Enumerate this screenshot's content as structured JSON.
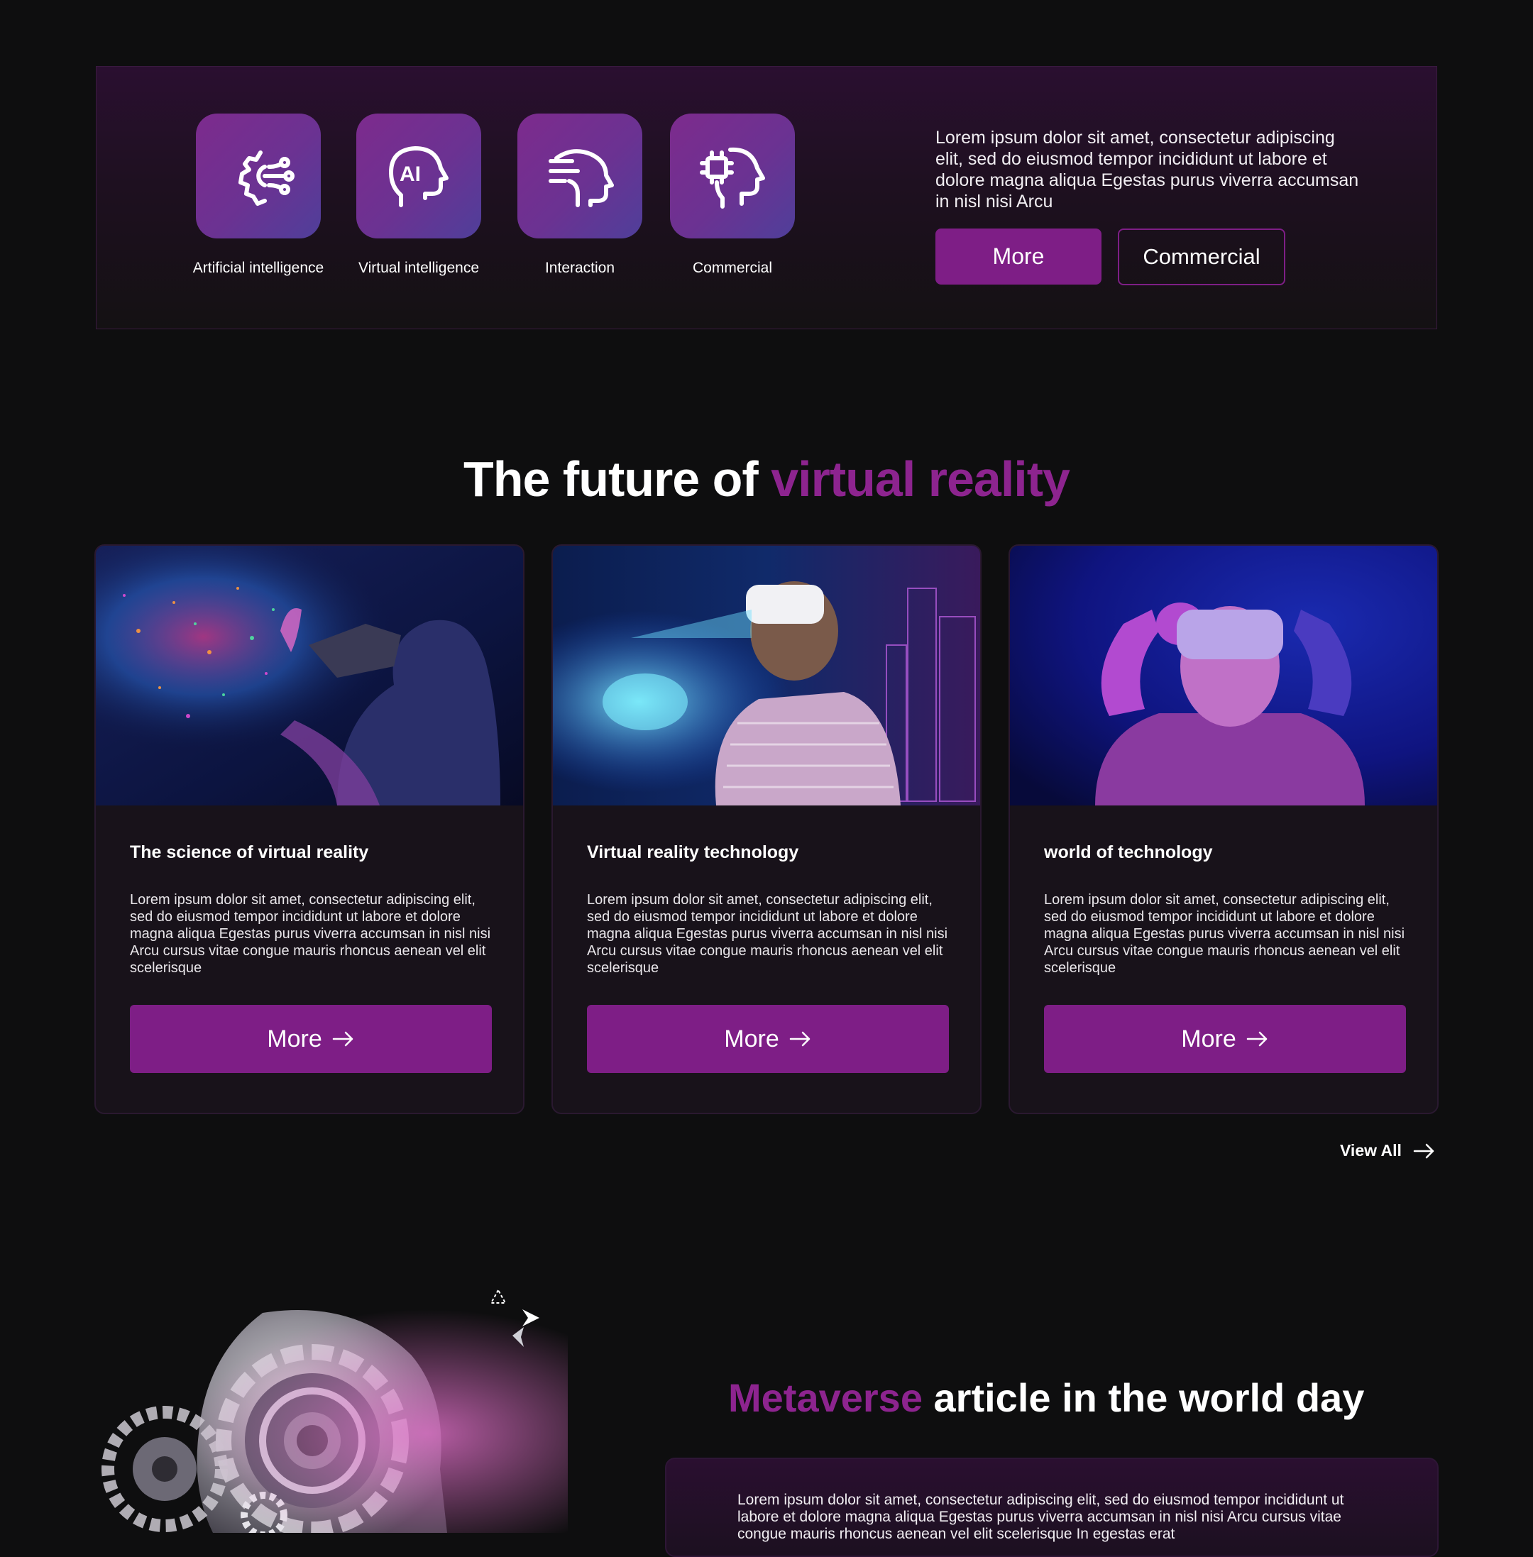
{
  "features": {
    "items": [
      {
        "label": "Artificial intelligence",
        "icon": "brain-network-icon"
      },
      {
        "label": "Virtual intelligence",
        "icon": "ai-head-icon"
      },
      {
        "label": "Interaction",
        "icon": "interaction-head-icon"
      },
      {
        "label": "Commercial",
        "icon": "chip-head-icon"
      }
    ],
    "description": "Lorem ipsum dolor sit amet, consectetur adipiscing elit, sed do eiusmod tempor incididunt ut labore et dolore magna aliqua Egestas purus viverra accumsan in nisl nisi Arcu",
    "more_label": "More",
    "commercial_label": "Commercial",
    "ai_badge": "AI"
  },
  "section": {
    "title_prefix": "The future of ",
    "title_accent": "virtual reality"
  },
  "cards": [
    {
      "title": "The science of virtual reality",
      "text": "Lorem ipsum dolor sit amet, consectetur adipiscing elit, sed do eiusmod tempor incididunt ut labore et dolore magna aliqua Egestas purus viverra accumsan in nisl nisi Arcu cursus vitae congue mauris rhoncus aenean vel elit scelerisque",
      "button": "More"
    },
    {
      "title": "Virtual reality technology",
      "text": "Lorem ipsum dolor sit amet, consectetur adipiscing elit, sed do eiusmod tempor incididunt ut labore et dolore magna aliqua Egestas purus viverra accumsan in nisl nisi Arcu cursus vitae congue mauris rhoncus aenean vel elit scelerisque",
      "button": "More"
    },
    {
      "title": "world of technology",
      "text": "Lorem ipsum dolor sit amet, consectetur adipiscing elit, sed do eiusmod tempor incididunt ut labore et dolore magna aliqua Egestas purus viverra accumsan in nisl nisi Arcu cursus vitae congue mauris rhoncus aenean vel elit scelerisque",
      "button": "More"
    }
  ],
  "view_all_label": "View All",
  "metaverse": {
    "title_accent": "Metaverse",
    "title_rest": " article in the world day",
    "text": "Lorem ipsum dolor sit amet, consectetur adipiscing elit, sed do eiusmod tempor incididunt ut labore et dolore magna aliqua Egestas purus viverra accumsan in nisl nisi Arcu cursus vitae congue mauris rhoncus aenean vel elit scelerisque In egestas erat"
  },
  "colors": {
    "accent": "#8d248f",
    "button": "#7e1e86",
    "background": "#0e0e0f",
    "card": "#18121a"
  }
}
